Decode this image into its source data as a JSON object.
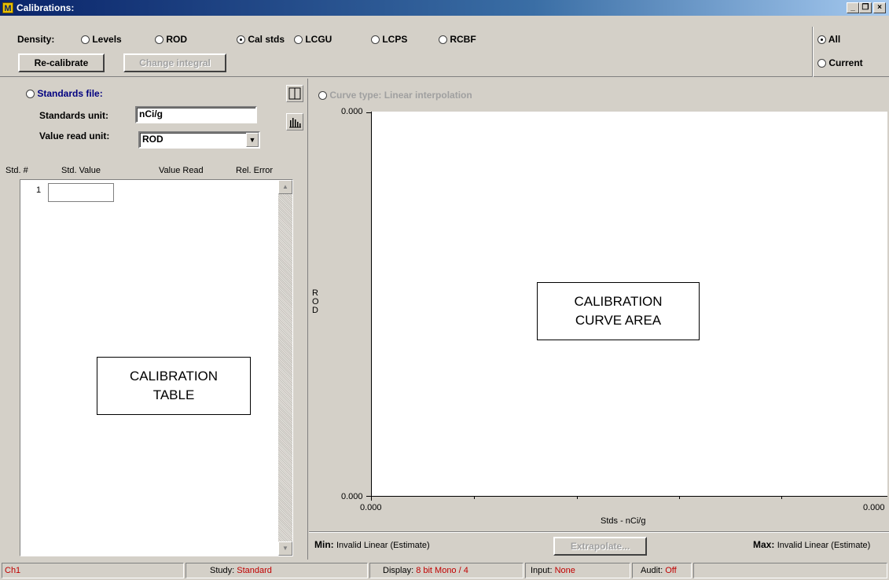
{
  "window": {
    "title": "Calibrations:",
    "icon_letter": "M",
    "min_glyph": "_",
    "max_glyph": "̶̶",
    "close_glyph": "×"
  },
  "density": {
    "label": "Density:",
    "options": [
      {
        "label": "Levels",
        "selected": false
      },
      {
        "label": "ROD",
        "selected": false
      },
      {
        "label": "Cal stds",
        "selected": true
      },
      {
        "label": "LCGU",
        "selected": false
      },
      {
        "label": "LCPS",
        "selected": false
      },
      {
        "label": "RCBF",
        "selected": false
      }
    ]
  },
  "toolbar": {
    "recalibrate": "Re-calibrate",
    "change_integral": "Change integral"
  },
  "scope": {
    "all": "All",
    "current": "Current"
  },
  "standards": {
    "file_label": "Standards file:",
    "unit_label": "Standards unit:",
    "unit_value": "nCi/g",
    "read_unit_label": "Value read unit:",
    "read_unit_value": "ROD"
  },
  "table": {
    "headers": [
      "Std. #",
      "Std. Value",
      "Value Read",
      "Rel. Error"
    ],
    "rows": [
      {
        "num": "1",
        "value": ""
      }
    ],
    "overlay_line1": "CALIBRATION",
    "overlay_line2": "TABLE"
  },
  "curve": {
    "type_label": "Curve type: Linear interpolation",
    "y_label": "R O D",
    "y_top": "0.000",
    "y_bottom": "0.000",
    "x_left": "0.000",
    "x_right": "0.000",
    "x_label": "Stds - nCi/g",
    "overlay_line1": "CALIBRATION",
    "overlay_line2": "CURVE AREA"
  },
  "footer": {
    "min_label": "Min:",
    "min_value": "Invalid Linear (Estimate)",
    "extrapolate": "Extrapolate...",
    "max_label": "Max:",
    "max_value": "Invalid Linear (Estimate)"
  },
  "status": {
    "channel": "Ch1",
    "study_label": "Study:",
    "study_value": "Standard",
    "display_label": "Display:",
    "display_value": "8 bit Mono / 4",
    "input_label": "Input:",
    "input_value": "None",
    "audit_label": "Audit:",
    "audit_value": "Off"
  }
}
